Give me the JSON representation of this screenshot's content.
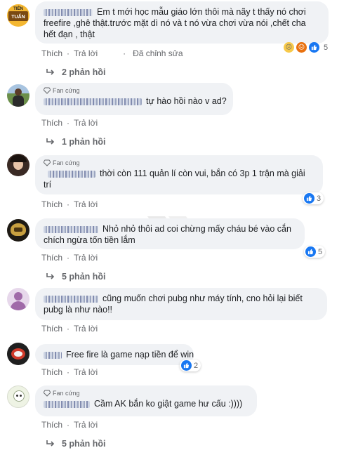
{
  "actions": {
    "like": "Thích",
    "reply": "Trả lời",
    "sep": "·",
    "edited": "Đã chỉnh sửa"
  },
  "badge_label": "Fan cứng",
  "avatar1_text": [
    "TIÊN",
    "TUẤN"
  ],
  "comments": [
    {
      "lines": [
        "Em t mới học mẫu giáo lớn thôi mà nãy t thấy nó chơi",
        "freefire ,ghê thật.trước mặt dì nó và t nó vừa chơi vừa nói ,chết cha",
        "hết đạn ,  thật"
      ],
      "reactions": "5",
      "replies": "2 phản hồi"
    },
    {
      "lines": [
        "tự hào hồi nào v ad?"
      ],
      "replies": "1 phản hồi"
    },
    {
      "lines": [
        "thời còn 111 quản lí còn vui, bắn có 3p 1 trận mà giải",
        "trí"
      ],
      "reactions": "3"
    },
    {
      "lines": [
        "Nhỏ nhỏ thôi ad coi chừng mấy cháu bé vào cắn",
        "chích ngừa tốn tiền lắm"
      ],
      "reactions": "5",
      "replies": "5 phản hồi"
    },
    {
      "lines": [
        "cũng muốn chơi pubg như máy tính, cno hỏi lại    biết",
        "pubg là như nào!!"
      ]
    },
    {
      "lines": [
        "Free fire là game nạp tiền để win"
      ],
      "reactions": "2"
    },
    {
      "lines": [
        "Cầm AK bắn ko giật game hư cấu :))))"
      ],
      "replies": "5 phản hồi"
    }
  ],
  "colors": {
    "bubble": "#f0f2f5",
    "like_blue": "#1877f2",
    "muted": "#65676b"
  }
}
